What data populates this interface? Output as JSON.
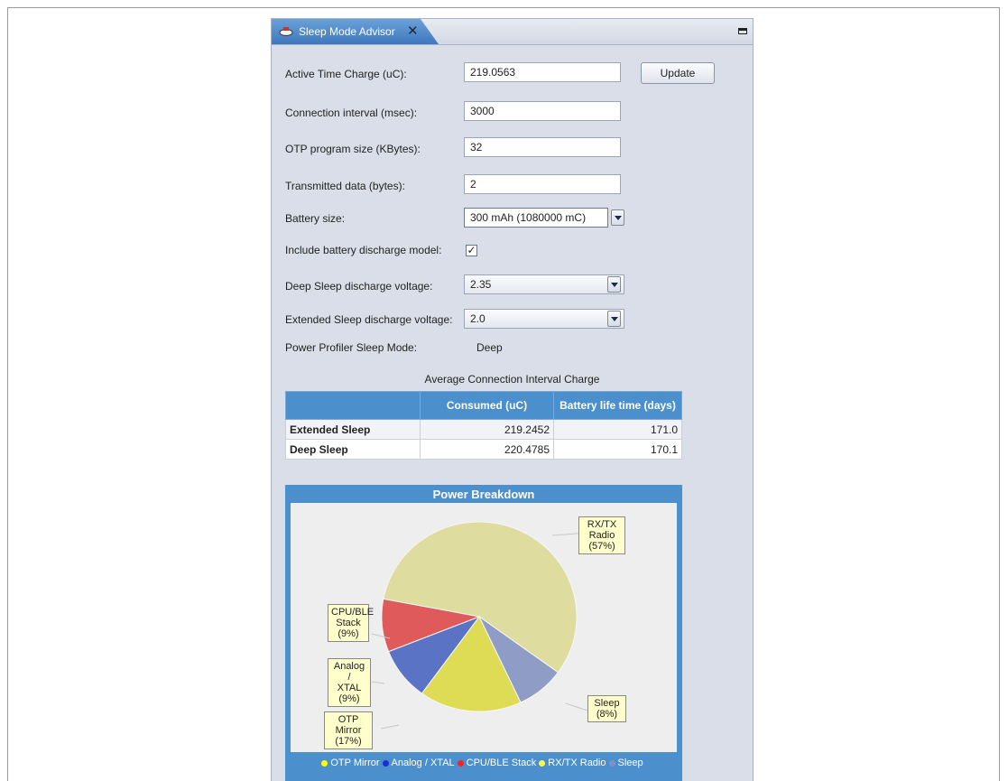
{
  "tab": {
    "title": "Sleep Mode Advisor",
    "close_glyph": "✕"
  },
  "form": {
    "active_time_charge": {
      "label": "Active Time Charge (uC):",
      "value": "219.0563"
    },
    "update_button": "Update",
    "connection_interval": {
      "label": "Connection interval (msec):",
      "value": "3000"
    },
    "otp_program_size": {
      "label": "OTP program size (KBytes):",
      "value": "32"
    },
    "transmitted_data": {
      "label": "Transmitted data (bytes):",
      "value": "2"
    },
    "battery_size": {
      "label": "Battery size:",
      "value": "300 mAh (1080000 mC)"
    },
    "include_discharge": {
      "label": "Include battery discharge model:",
      "checked": true,
      "check_glyph": "✓"
    },
    "deep_sleep_voltage": {
      "label": "Deep Sleep discharge voltage:",
      "value": "2.35"
    },
    "extended_sleep_voltage": {
      "label": "Extended Sleep discharge voltage:",
      "value": "2.0"
    },
    "power_profiler_mode": {
      "label": "Power Profiler Sleep Mode:",
      "value": "Deep"
    }
  },
  "table": {
    "title": "Average Connection Interval Charge",
    "headers": [
      "",
      "Consumed (uC)",
      "Battery life time (days)"
    ],
    "rows": [
      {
        "label": "Extended Sleep",
        "consumed": "219.2452",
        "life": "171.0"
      },
      {
        "label": "Deep Sleep",
        "consumed": "220.4785",
        "life": "170.1"
      }
    ]
  },
  "chart_data": {
    "type": "pie",
    "title": "Power Breakdown",
    "slices": [
      {
        "name": "RX/TX Radio",
        "value": 57,
        "color": "#dedd9f",
        "callout": [
          "RX/TX",
          "Radio",
          "(57%)"
        ]
      },
      {
        "name": "Sleep",
        "value": 8,
        "color": "#8e9cc6",
        "callout": [
          "Sleep",
          "(8%)"
        ]
      },
      {
        "name": "OTP Mirror",
        "value": 17,
        "color": "#dedc55",
        "callout": [
          "OTP Mirror",
          "(17%)"
        ]
      },
      {
        "name": "Analog / XTAL",
        "value": 9,
        "color": "#5a73c5",
        "callout": [
          "Analog /",
          "XTAL",
          "(9%)"
        ]
      },
      {
        "name": "CPU/BLE Stack",
        "value": 9,
        "color": "#df5a5a",
        "callout": [
          "CPU/BLE",
          "Stack",
          "(9%)"
        ]
      }
    ],
    "legend": [
      {
        "name": "OTP Mirror",
        "color": "#ffff00"
      },
      {
        "name": "Analog / XTAL",
        "color": "#1a2fd0"
      },
      {
        "name": "CPU/BLE Stack",
        "color": "#ff2020"
      },
      {
        "name": "RX/TX Radio",
        "color": "#ffff40"
      },
      {
        "name": "Sleep",
        "color": "#8090c8"
      }
    ]
  }
}
